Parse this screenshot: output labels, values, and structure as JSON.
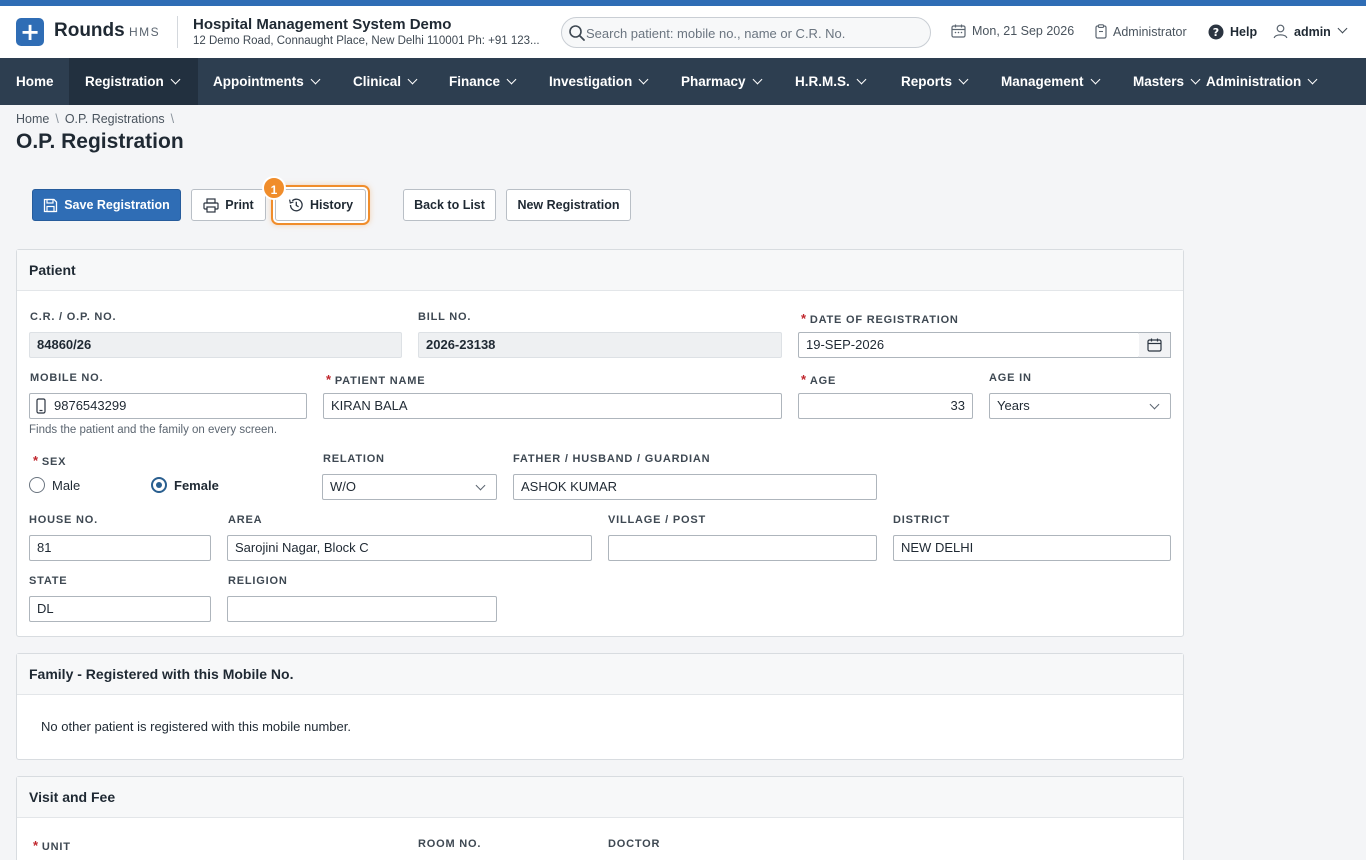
{
  "header": {
    "brand": "Rounds",
    "brand_sub": "HMS",
    "hospital_name": "Hospital Management System Demo",
    "hospital_address": "12 Demo Road, Connaught Place, New Delhi 110001 Ph: +91 123...",
    "search_placeholder": "Search patient: mobile no., name or C.R. No.",
    "date": "Mon, 21 Sep 2026",
    "role": "Administrator",
    "help": "Help",
    "user": "admin"
  },
  "nav": {
    "items": [
      "Home",
      "Registration",
      "Appointments",
      "Clinical",
      "Finance",
      "Investigation",
      "Pharmacy",
      "H.R.M.S.",
      "Reports",
      "Management",
      "Masters",
      "Administration"
    ],
    "active": "Registration"
  },
  "breadcrumb": [
    "Home",
    "O.P. Registrations"
  ],
  "page_title": "O.P. Registration",
  "toolbar": {
    "save": "Save Registration",
    "print": "Print",
    "history": "History",
    "back": "Back to List",
    "new": "New Registration",
    "badge": "1"
  },
  "patient": {
    "title": "Patient",
    "cr_label": "C.R. / O.P. NO.",
    "cr_value": "84860/26",
    "bill_label": "BILL NO.",
    "bill_value": "2026-23138",
    "date_label": "DATE OF REGISTRATION",
    "date_value": "19-SEP-2026",
    "mobile_label": "MOBILE NO.",
    "mobile_value": "9876543299",
    "mobile_hint": "Finds the patient and the family on every screen.",
    "name_label": "PATIENT NAME",
    "name_value": "KIRAN BALA",
    "age_label": "AGE",
    "age_value": "33",
    "age_in_label": "AGE IN",
    "age_in_value": "Years",
    "sex_label": "SEX",
    "sex_male": "Male",
    "sex_female": "Female",
    "relation_label": "RELATION",
    "relation_value": "W/O",
    "guardian_label": "FATHER / HUSBAND / GUARDIAN",
    "guardian_value": "ASHOK KUMAR",
    "house_label": "HOUSE NO.",
    "house_value": "81",
    "area_label": "AREA",
    "area_value": "Sarojini Nagar, Block C",
    "village_label": "VILLAGE / POST",
    "village_value": "",
    "district_label": "DISTRICT",
    "district_value": "NEW DELHI",
    "state_label": "STATE",
    "state_value": "DL",
    "religion_label": "RELIGION",
    "religion_value": ""
  },
  "family": {
    "title": "Family - Registered with this Mobile No.",
    "empty_text": "No other patient is registered with this mobile number."
  },
  "visit": {
    "title": "Visit and Fee",
    "unit_label": "UNIT",
    "room_label": "ROOM NO.",
    "doctor_label": "DOCTOR"
  },
  "colors": {
    "primary": "#2f6db5",
    "nav_bg": "#2d3e50",
    "highlight": "#f08d2b",
    "required": "#c0262d"
  }
}
